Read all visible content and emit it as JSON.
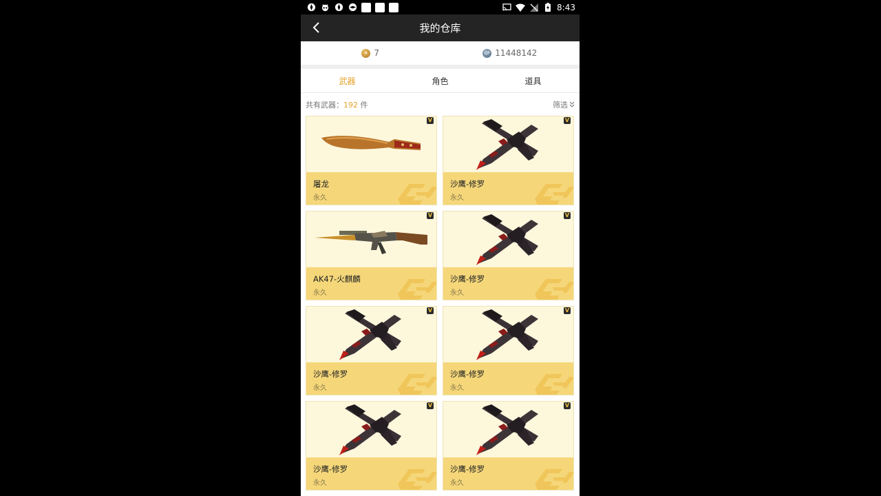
{
  "status": {
    "time": "8:43"
  },
  "header": {
    "title": "我的仓库"
  },
  "currency": {
    "gold": "7",
    "gp": "11448142",
    "gp_icon_text": "GP"
  },
  "tabs": [
    {
      "label": "武器",
      "active": true
    },
    {
      "label": "角色",
      "active": false
    },
    {
      "label": "道具",
      "active": false
    }
  ],
  "summary": {
    "prefix": "共有武器：",
    "count": "192",
    "suffix": " 件",
    "filter_label": "筛选"
  },
  "items": [
    {
      "name": "屠龙",
      "duration": "永久",
      "icon": "machete-weapon",
      "badge": "V"
    },
    {
      "name": "沙鹰-修罗",
      "duration": "永久",
      "icon": "dual-pistol-weapon",
      "badge": "V"
    },
    {
      "name": "AK47-火麒麟",
      "duration": "永久",
      "icon": "rifle-weapon",
      "badge": "V"
    },
    {
      "name": "沙鹰-修罗",
      "duration": "永久",
      "icon": "dual-pistol-weapon",
      "badge": "V"
    },
    {
      "name": "沙鹰-修罗",
      "duration": "永久",
      "icon": "dual-pistol-weapon",
      "badge": "V"
    },
    {
      "name": "沙鹰-修罗",
      "duration": "永久",
      "icon": "dual-pistol-weapon",
      "badge": "V"
    },
    {
      "name": "沙鹰-修罗",
      "duration": "永久",
      "icon": "dual-pistol-weapon",
      "badge": "V"
    },
    {
      "name": "沙鹰-修罗",
      "duration": "永久",
      "icon": "dual-pistol-weapon",
      "badge": "V"
    }
  ],
  "colors": {
    "accent": "#e6a22c",
    "card_bg": "#fdf7dc",
    "card_label_bg": "#f5d77a",
    "navbar": "#242424"
  }
}
